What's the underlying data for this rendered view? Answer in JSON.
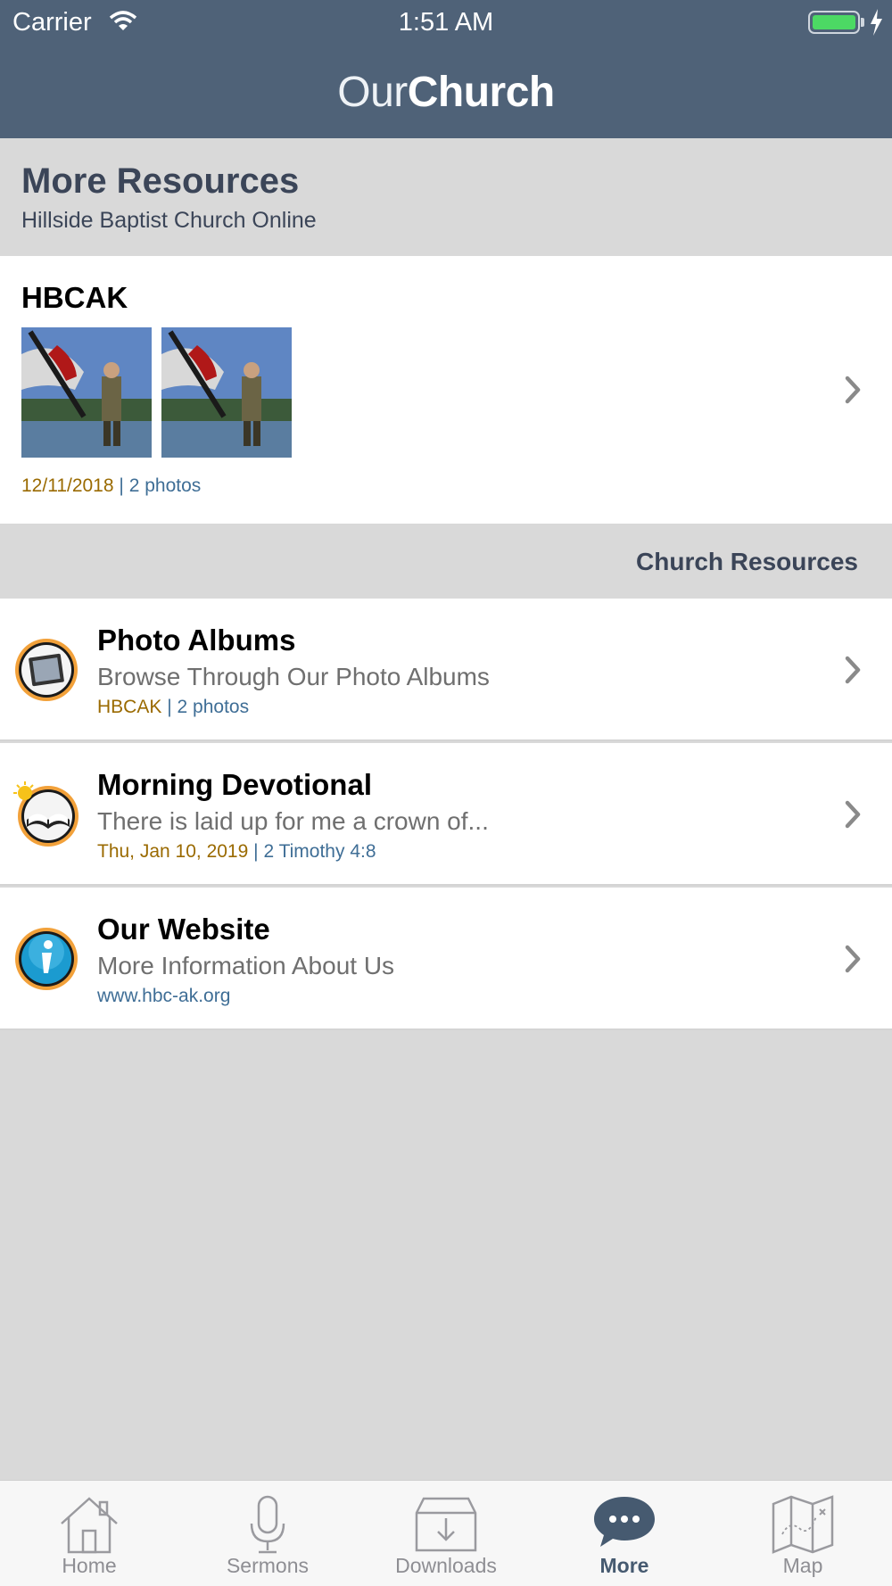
{
  "status_bar": {
    "carrier": "Carrier",
    "time": "1:51 AM"
  },
  "brand": {
    "light": "Our",
    "bold": "Church"
  },
  "page": {
    "title": "More Resources",
    "subtitle": "Hillside Baptist Church Online"
  },
  "featured": {
    "title": "HBCAK",
    "date": "12/11/2018",
    "separator": "|",
    "count": "2 photos"
  },
  "section": {
    "title": "Church Resources"
  },
  "rows": [
    {
      "title": "Photo Albums",
      "subtitle": "Browse Through Our Photo Albums",
      "meta_primary": "HBCAK",
      "separator": "|",
      "meta_secondary": "2 photos",
      "icon": "photo-album-icon"
    },
    {
      "title": "Morning Devotional",
      "subtitle": "There is laid up for me a crown of...",
      "meta_primary": "Thu, Jan 10, 2019",
      "separator": "|",
      "meta_secondary": "2 Timothy 4:8",
      "icon": "devotional-book-icon"
    },
    {
      "title": "Our Website",
      "subtitle": "More Information About Us",
      "meta_primary": "",
      "separator": "",
      "meta_secondary": "www.hbc-ak.org",
      "icon": "info-icon"
    }
  ],
  "tabs": [
    {
      "label": "Home",
      "icon": "home-icon"
    },
    {
      "label": "Sermons",
      "icon": "microphone-icon"
    },
    {
      "label": "Downloads",
      "icon": "download-icon"
    },
    {
      "label": "More",
      "icon": "chat-bubble-icon",
      "active": true
    },
    {
      "label": "Map",
      "icon": "map-icon"
    }
  ],
  "colors": {
    "header": "#4f6278",
    "accent_date": "#9a6a00",
    "accent_link": "#3f6e96",
    "battery": "#4cd964"
  }
}
